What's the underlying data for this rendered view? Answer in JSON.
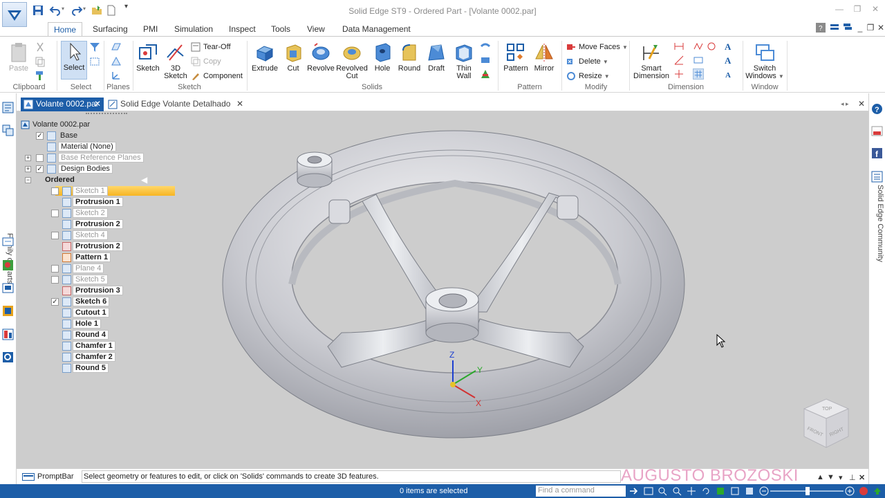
{
  "window": {
    "title": "Solid Edge ST9 - Ordered Part - [Volante 0002.par]",
    "help_label": "?"
  },
  "ribbon_tabs": [
    "Home",
    "Surfacing",
    "PMI",
    "Simulation",
    "Inspect",
    "Tools",
    "View",
    "Data Management"
  ],
  "ribbon": {
    "clipboard": {
      "paste": "Paste",
      "group": "Clipboard"
    },
    "select": {
      "select": "Select",
      "group": "Select"
    },
    "planes": {
      "group": "Planes"
    },
    "sketch": {
      "sketch": "Sketch",
      "sketch3d_line1": "3D",
      "sketch3d_line2": "Sketch",
      "tear_off": "Tear-Off",
      "copy": "Copy",
      "component": "Component",
      "group": "Sketch"
    },
    "solids": {
      "extrude": "Extrude",
      "cut": "Cut",
      "revolve": "Revolve",
      "revolved_cut_line1": "Revolved",
      "revolved_cut_line2": "Cut",
      "hole": "Hole",
      "round": "Round",
      "draft": "Draft",
      "thin_wall_line1": "Thin",
      "thin_wall_line2": "Wall",
      "group": "Solids"
    },
    "pattern": {
      "pattern": "Pattern",
      "mirror": "Mirror",
      "group": "Pattern"
    },
    "modify": {
      "move_faces": "Move Faces",
      "delete": "Delete",
      "resize": "Resize",
      "group": "Modify"
    },
    "dimension": {
      "smart_line1": "Smart",
      "smart_line2": "Dimension",
      "group": "Dimension"
    },
    "window": {
      "switch_line1": "Switch",
      "switch_line2": "Windows",
      "group": "Window"
    }
  },
  "left_dock": {
    "family_label": "Family of Parts"
  },
  "right_dock": {
    "community_label": "Solid Edge Community"
  },
  "doc_tabs": [
    {
      "label": "Volante 0002.par"
    },
    {
      "label": "Solid Edge Volante Detalhado 0..."
    }
  ],
  "pathfinder": {
    "root": "Volante 0002.par",
    "items": [
      "Base",
      "Material (None)",
      "Base Reference Planes",
      "Design Bodies",
      "Ordered",
      "Sketch 1",
      "Protrusion 1",
      "Sketch 2",
      "Protrusion 2",
      "Sketch 4",
      "Protrusion 2",
      "Pattern 1",
      "Plane 4",
      "Sketch 5",
      "Protrusion 3",
      "Sketch 6",
      "Cutout 1",
      "Hole 1",
      "Round 4",
      "Chamfer 1",
      "Chamfer 2",
      "Round 5"
    ]
  },
  "triad": {
    "x": "X",
    "y": "Y",
    "z": "Z"
  },
  "view_cube": {
    "top": "TOP",
    "front": "FRONT",
    "right": "RIGHT"
  },
  "promptbar": {
    "label": "PromptBar",
    "message": "Select geometry or features to edit, or click on 'Solids' commands to create 3D features.",
    "watermark": "AUGUSTO BROZOSKI"
  },
  "statusbar": {
    "selection": "0 items are selected",
    "find_placeholder": "Find a command"
  },
  "colors": {
    "accent": "#1d5ea8",
    "ordered_highlight": "#f7b523",
    "viewport_bg": "#cdcdcd",
    "watermark": "#e8a4c6"
  }
}
